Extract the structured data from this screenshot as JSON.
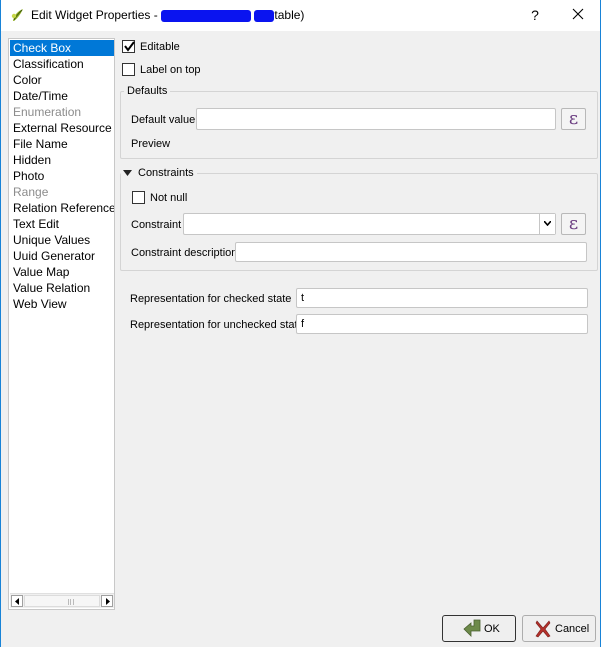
{
  "window": {
    "title_prefix": "Edit Widget Properties - ",
    "title_suffix": " (",
    "title_suffix2": "table)",
    "help_label": "?",
    "close_icon": "close-icon",
    "app_icon": "qgis-icon"
  },
  "widget_types": {
    "items": [
      {
        "label": "Check Box",
        "selected": true,
        "disabled": false
      },
      {
        "label": "Classification",
        "selected": false,
        "disabled": false
      },
      {
        "label": "Color",
        "selected": false,
        "disabled": false
      },
      {
        "label": "Date/Time",
        "selected": false,
        "disabled": false
      },
      {
        "label": "Enumeration",
        "selected": false,
        "disabled": true
      },
      {
        "label": "External Resource",
        "selected": false,
        "disabled": false
      },
      {
        "label": "File Name",
        "selected": false,
        "disabled": false
      },
      {
        "label": "Hidden",
        "selected": false,
        "disabled": false
      },
      {
        "label": "Photo",
        "selected": false,
        "disabled": false
      },
      {
        "label": "Range",
        "selected": false,
        "disabled": true
      },
      {
        "label": "Relation Reference",
        "selected": false,
        "disabled": false
      },
      {
        "label": "Text Edit",
        "selected": false,
        "disabled": false
      },
      {
        "label": "Unique Values",
        "selected": false,
        "disabled": false
      },
      {
        "label": "Uuid Generator",
        "selected": false,
        "disabled": false
      },
      {
        "label": "Value Map",
        "selected": false,
        "disabled": false
      },
      {
        "label": "Value Relation",
        "selected": false,
        "disabled": false
      },
      {
        "label": "Web View",
        "selected": false,
        "disabled": false
      }
    ]
  },
  "general": {
    "editable_label": "Editable",
    "editable_checked": true,
    "label_on_top_label": "Label on top",
    "label_on_top_checked": false
  },
  "defaults": {
    "group_title": "Defaults",
    "default_value_label": "Default value",
    "default_value": "",
    "expression_symbol": "ε",
    "preview_label": "Preview"
  },
  "constraints": {
    "group_title": "Constraints",
    "expanded": true,
    "not_null_label": "Not null",
    "not_null_checked": false,
    "constraint_label": "Constraint",
    "constraint_value": "",
    "expression_symbol": "ε",
    "constraint_description_label": "Constraint description",
    "constraint_description_value": ""
  },
  "checkbox_config": {
    "checked_state_label": "Representation for checked state",
    "checked_state_value": "t",
    "unchecked_state_label": "Representation for unchecked state",
    "unchecked_state_value": "f"
  },
  "buttons": {
    "ok_label": "OK",
    "cancel_label": "Cancel"
  },
  "colors": {
    "selection": "#0078d7",
    "window_border": "#1883d7",
    "redaction": "#0a14f0",
    "expression_glyph": "#6a3c80"
  }
}
